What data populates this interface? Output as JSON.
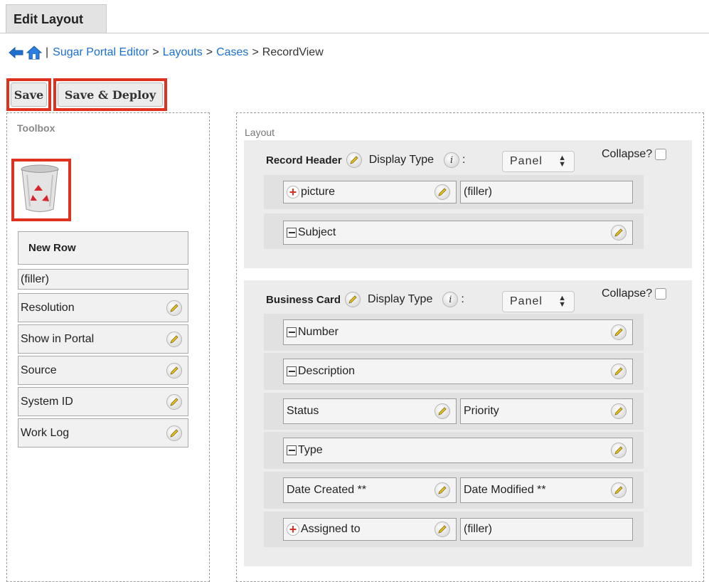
{
  "tab": {
    "label": "Edit Layout"
  },
  "breadcrumb": {
    "items": [
      "Sugar Portal Editor",
      "Layouts",
      "Cases"
    ],
    "current": "RecordView",
    "separator": ">"
  },
  "buttons": {
    "save": "Save",
    "save_deploy": "Save & Deploy"
  },
  "toolbox": {
    "title": "Toolbox",
    "new_row": "New Row",
    "filler": "(filler)",
    "fields": [
      "Resolution",
      "Show in Portal",
      "Source",
      "System ID",
      "Work Log"
    ]
  },
  "layout": {
    "title": "Layout",
    "display_type_label": "Display Type",
    "colon": ":",
    "collapse_label": "Collapse?",
    "panels": [
      {
        "name": "Record Header",
        "display_type": "Panel",
        "rows": [
          [
            "picture",
            "(filler)"
          ],
          [
            "Subject"
          ]
        ]
      },
      {
        "name": "Business Card",
        "display_type": "Panel",
        "rows": [
          [
            "Number"
          ],
          [
            "Description"
          ],
          [
            "Status",
            "Priority"
          ],
          [
            "Type"
          ],
          [
            "Date Created **",
            "Date Modified **"
          ],
          [
            "Assigned to",
            "(filler)"
          ]
        ]
      }
    ]
  },
  "colors": {
    "highlight": "#e0311e",
    "link": "#1a6fd1"
  }
}
